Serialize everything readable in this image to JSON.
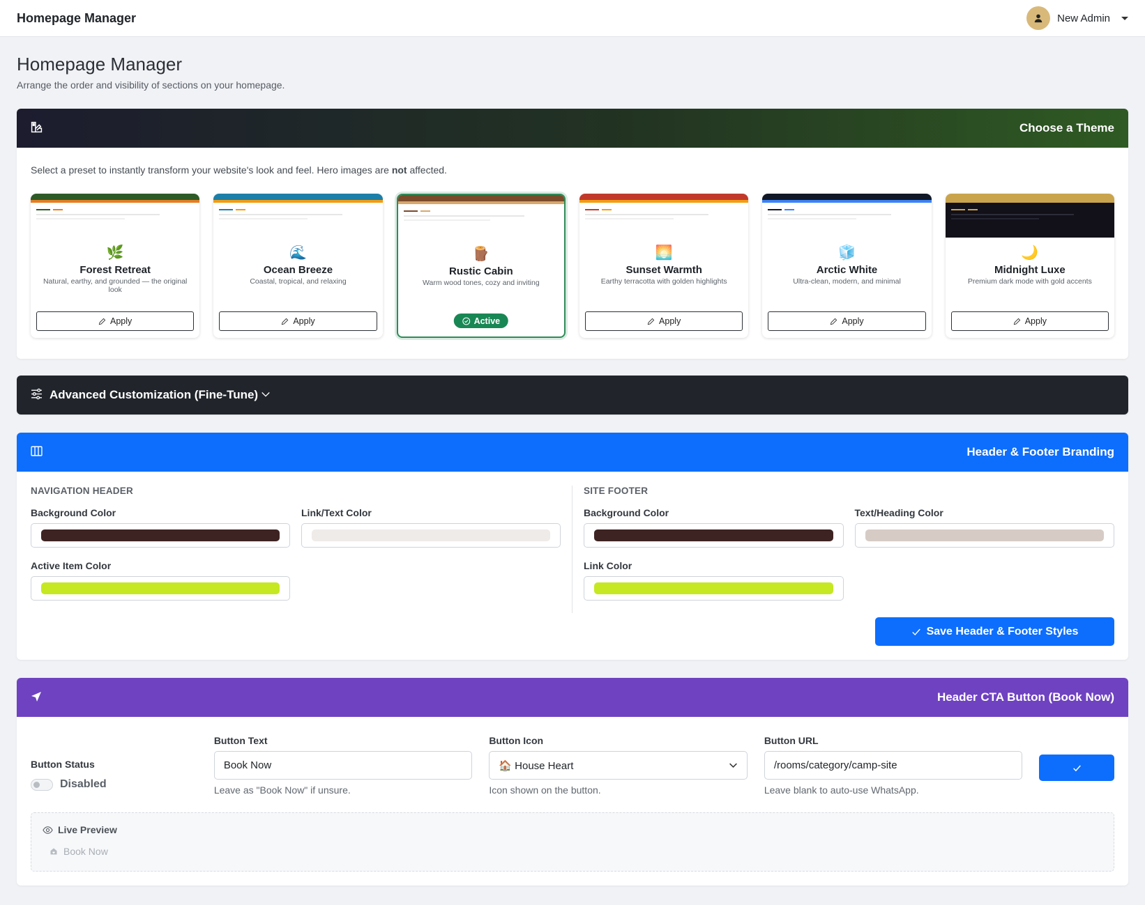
{
  "topbar": {
    "title": "Homepage Manager",
    "user_name": "New Admin"
  },
  "page": {
    "title": "Homepage Manager",
    "subtitle": "Arrange the order and visibility of sections on your homepage."
  },
  "theme_section": {
    "title": "Choose a Theme",
    "intro_before": "Select a preset to instantly transform your website's look and feel. Hero images are ",
    "intro_bold": "not",
    "intro_after": " affected.",
    "apply_label": "Apply",
    "active_label": "Active",
    "themes": [
      {
        "name": "Forest Retreat",
        "desc": "Natural, earthy, and grounded — the original look",
        "emoji": "🌿",
        "primary": "#2d5a27",
        "accent": "#e67e22",
        "dark": false,
        "active": false
      },
      {
        "name": "Ocean Breeze",
        "desc": "Coastal, tropical, and relaxing",
        "emoji": "🌊",
        "primary": "#1b7fa8",
        "accent": "#f39c12",
        "dark": false,
        "active": false
      },
      {
        "name": "Rustic Cabin",
        "desc": "Warm wood tones, cozy and inviting",
        "emoji": "🪵",
        "primary": "#7b4a2a",
        "accent": "#d7a86e",
        "dark": false,
        "active": true
      },
      {
        "name": "Sunset Warmth",
        "desc": "Earthy terracotta with golden highlights",
        "emoji": "🌅",
        "primary": "#c0392b",
        "accent": "#f39c12",
        "dark": false,
        "active": false
      },
      {
        "name": "Arctic White",
        "desc": "Ultra-clean, modern, and minimal",
        "emoji": "🧊",
        "primary": "#111827",
        "accent": "#3b82f6",
        "dark": false,
        "active": false
      },
      {
        "name": "Midnight Luxe",
        "desc": "Premium dark mode with gold accents",
        "emoji": "🌙",
        "primary": "#c9a44c",
        "accent": "#c9a44c",
        "dark": true,
        "active": false
      }
    ]
  },
  "advanced": {
    "title": "Advanced Customization (Fine-Tune)"
  },
  "branding": {
    "title": "Header & Footer Branding",
    "nav_header": {
      "caption": "NAVIGATION HEADER",
      "bg_label": "Background Color",
      "bg_color": "#3d2322",
      "text_label": "Link/Text Color",
      "text_color": "#efebe8",
      "active_label": "Active Item Color",
      "active_color": "#c5e823"
    },
    "site_footer": {
      "caption": "SITE FOOTER",
      "bg_label": "Background Color",
      "bg_color": "#3d2322",
      "text_label": "Text/Heading Color",
      "text_color": "#d7cbc6",
      "link_label": "Link Color",
      "link_color": "#c5e823"
    },
    "save_label": "Save Header & Footer Styles"
  },
  "cta": {
    "title": "Header CTA Button (Book Now)",
    "status_label": "Button Status",
    "status_value": "Disabled",
    "text_label": "Button Text",
    "text_value": "Book Now",
    "text_hint": "Leave as \"Book Now\" if unsure.",
    "icon_label": "Button Icon",
    "icon_value": "🏠 House Heart",
    "icon_hint": "Icon shown on the button.",
    "url_label": "Button URL",
    "url_value": "/rooms/category/camp-site",
    "url_hint": "Leave blank to auto-use WhatsApp.",
    "preview_label": "Live Preview",
    "preview_button": "Book Now"
  }
}
